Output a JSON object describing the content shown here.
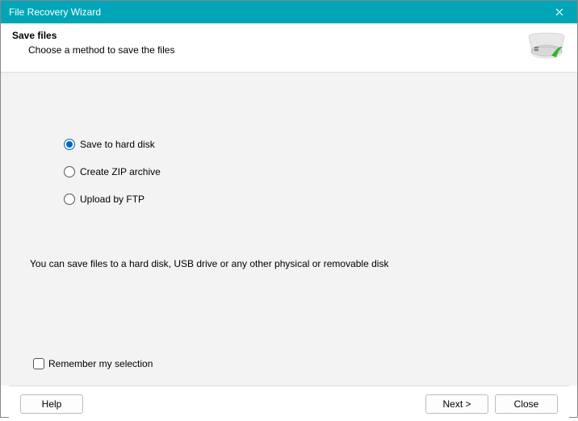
{
  "window": {
    "title": "File Recovery Wizard"
  },
  "header": {
    "title": "Save files",
    "subtitle": "Choose a method to save the files"
  },
  "options": [
    {
      "label": "Save to hard disk",
      "checked": true
    },
    {
      "label": "Create ZIP archive",
      "checked": false
    },
    {
      "label": "Upload by FTP",
      "checked": false
    }
  ],
  "hint": "You can save files to a hard disk, USB drive or any other physical or removable disk",
  "remember": {
    "label": "Remember my selection",
    "checked": false
  },
  "buttons": {
    "help": "Help",
    "next": "Next >",
    "close": "Close"
  }
}
